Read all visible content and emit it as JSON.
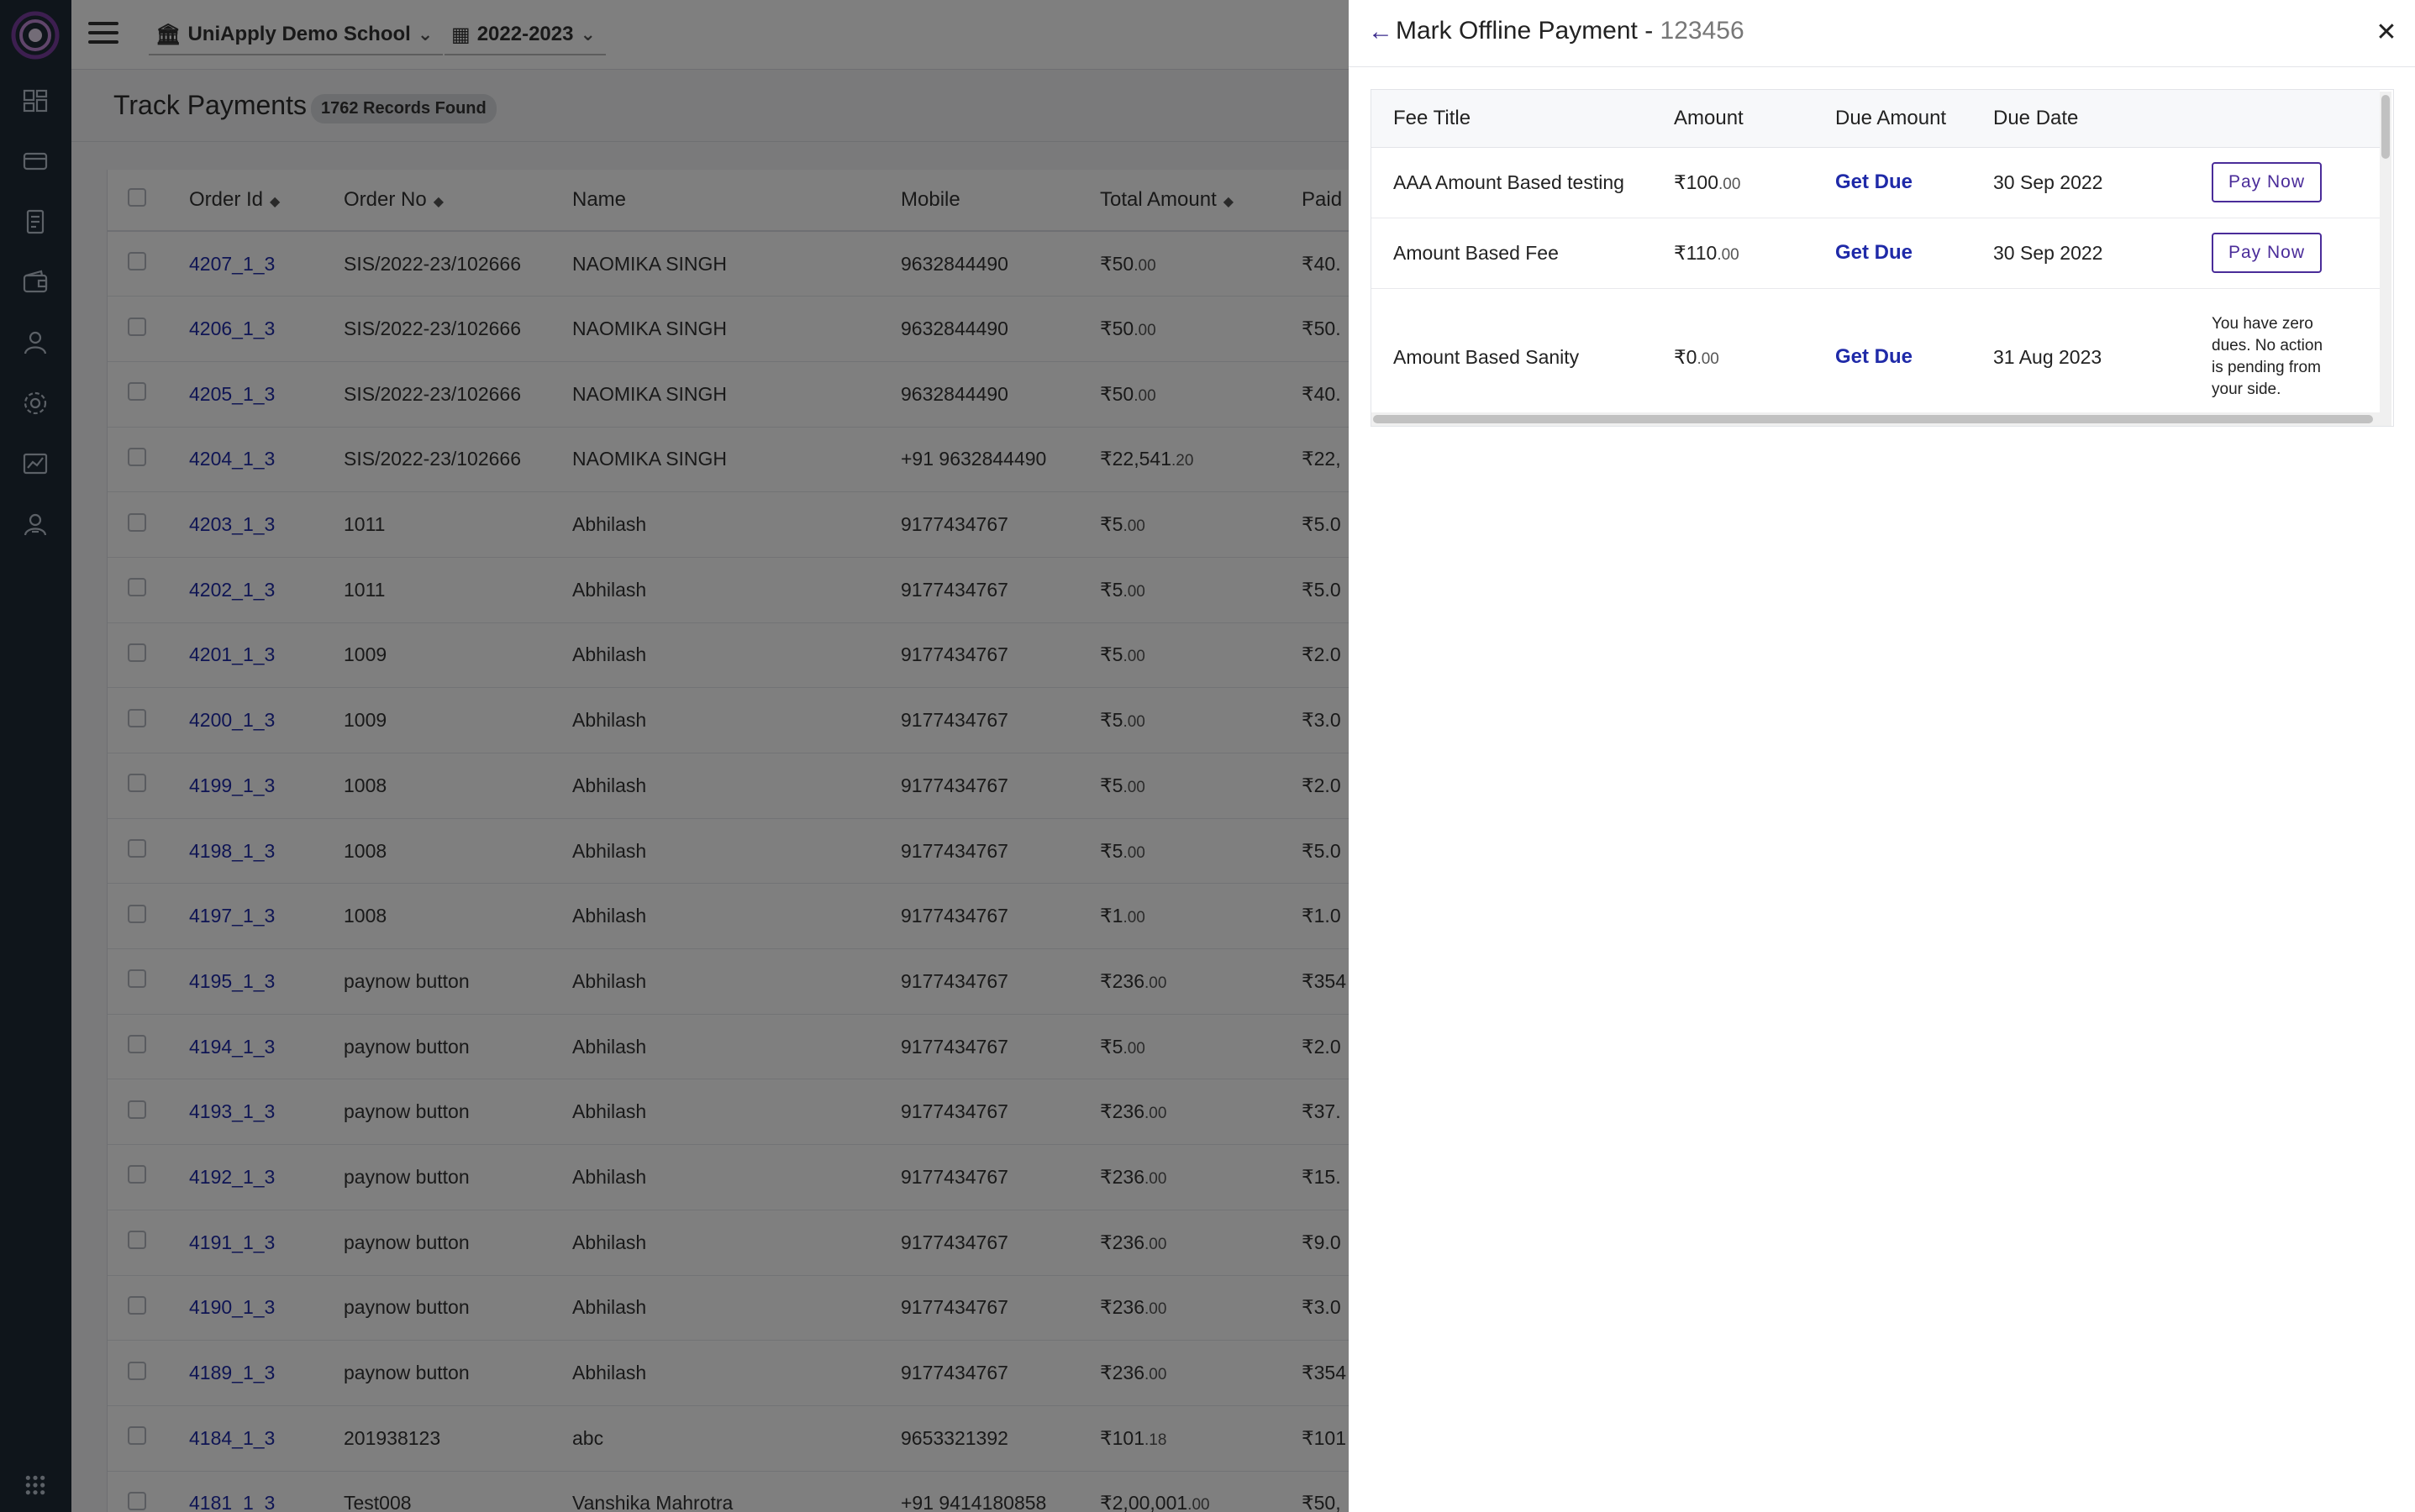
{
  "sidebar": {
    "icons": [
      "dashboard-icon",
      "card-icon",
      "document-icon",
      "wallet-icon",
      "user-icon",
      "settings-icon",
      "report-icon",
      "admin-icon"
    ],
    "bottom_icon": "apps-grid-icon"
  },
  "topbar": {
    "school": "UniApply Demo School",
    "session": "2022-2023"
  },
  "page": {
    "title": "Track Payments",
    "records": "1762 Records Found"
  },
  "orders_table": {
    "columns": [
      "Order Id",
      "Order No",
      "Name",
      "Mobile",
      "Total Amount",
      "Paid"
    ],
    "rows": [
      {
        "id": "4207_1_3",
        "no": "SIS/2022-23/102666",
        "name": "NAOMIKA SINGH",
        "mobile": "9632844490",
        "total": "₹50",
        "total_dec": ".00",
        "paid": "₹40."
      },
      {
        "id": "4206_1_3",
        "no": "SIS/2022-23/102666",
        "name": "NAOMIKA SINGH",
        "mobile": "9632844490",
        "total": "₹50",
        "total_dec": ".00",
        "paid": "₹50."
      },
      {
        "id": "4205_1_3",
        "no": "SIS/2022-23/102666",
        "name": "NAOMIKA SINGH",
        "mobile": "9632844490",
        "total": "₹50",
        "total_dec": ".00",
        "paid": "₹40."
      },
      {
        "id": "4204_1_3",
        "no": "SIS/2022-23/102666",
        "name": "NAOMIKA SINGH",
        "mobile": "+91 9632844490",
        "total": "₹22,541",
        "total_dec": ".20",
        "paid": "₹22,"
      },
      {
        "id": "4203_1_3",
        "no": "1011",
        "name": "Abhilash",
        "mobile": "9177434767",
        "total": "₹5",
        "total_dec": ".00",
        "paid": "₹5.0"
      },
      {
        "id": "4202_1_3",
        "no": "1011",
        "name": "Abhilash",
        "mobile": "9177434767",
        "total": "₹5",
        "total_dec": ".00",
        "paid": "₹5.0"
      },
      {
        "id": "4201_1_3",
        "no": "1009",
        "name": "Abhilash",
        "mobile": "9177434767",
        "total": "₹5",
        "total_dec": ".00",
        "paid": "₹2.0"
      },
      {
        "id": "4200_1_3",
        "no": "1009",
        "name": "Abhilash",
        "mobile": "9177434767",
        "total": "₹5",
        "total_dec": ".00",
        "paid": "₹3.0"
      },
      {
        "id": "4199_1_3",
        "no": "1008",
        "name": "Abhilash",
        "mobile": "9177434767",
        "total": "₹5",
        "total_dec": ".00",
        "paid": "₹2.0"
      },
      {
        "id": "4198_1_3",
        "no": "1008",
        "name": "Abhilash",
        "mobile": "9177434767",
        "total": "₹5",
        "total_dec": ".00",
        "paid": "₹5.0"
      },
      {
        "id": "4197_1_3",
        "no": "1008",
        "name": "Abhilash",
        "mobile": "9177434767",
        "total": "₹1",
        "total_dec": ".00",
        "paid": "₹1.0"
      },
      {
        "id": "4195_1_3",
        "no": "paynow button",
        "name": "Abhilash",
        "mobile": "9177434767",
        "total": "₹236",
        "total_dec": ".00",
        "paid": "₹354"
      },
      {
        "id": "4194_1_3",
        "no": "paynow button",
        "name": "Abhilash",
        "mobile": "9177434767",
        "total": "₹5",
        "total_dec": ".00",
        "paid": "₹2.0"
      },
      {
        "id": "4193_1_3",
        "no": "paynow button",
        "name": "Abhilash",
        "mobile": "9177434767",
        "total": "₹236",
        "total_dec": ".00",
        "paid": "₹37."
      },
      {
        "id": "4192_1_3",
        "no": "paynow button",
        "name": "Abhilash",
        "mobile": "9177434767",
        "total": "₹236",
        "total_dec": ".00",
        "paid": "₹15."
      },
      {
        "id": "4191_1_3",
        "no": "paynow button",
        "name": "Abhilash",
        "mobile": "9177434767",
        "total": "₹236",
        "total_dec": ".00",
        "paid": "₹9.0"
      },
      {
        "id": "4190_1_3",
        "no": "paynow button",
        "name": "Abhilash",
        "mobile": "9177434767",
        "total": "₹236",
        "total_dec": ".00",
        "paid": "₹3.0"
      },
      {
        "id": "4189_1_3",
        "no": "paynow button",
        "name": "Abhilash",
        "mobile": "9177434767",
        "total": "₹236",
        "total_dec": ".00",
        "paid": "₹354"
      },
      {
        "id": "4184_1_3",
        "no": "201938123",
        "name": "abc",
        "mobile": "9653321392",
        "total": "₹101",
        "total_dec": ".18",
        "paid": "₹101"
      },
      {
        "id": "4181_1_3",
        "no": "Test008",
        "name": "Vanshika Mahrotra",
        "mobile": "+91 9414180858",
        "total": "₹2,00,001",
        "total_dec": ".00",
        "paid": "₹50,"
      }
    ]
  },
  "drawer": {
    "title": "Mark Offline Payment - ",
    "transaction_id": "123456",
    "columns": [
      "Fee Title",
      "Amount",
      "Due Amount",
      "Due Date"
    ],
    "rows": [
      {
        "title": "AAA Amount Based testing",
        "amount": "₹100",
        "amount_dec": ".00",
        "due": "Get Due",
        "date": "30 Sep 2022",
        "action": "Pay Now"
      },
      {
        "title": "Amount Based Fee",
        "amount": "₹110",
        "amount_dec": ".00",
        "due": "Get Due",
        "date": "30 Sep 2022",
        "action": "Pay Now"
      },
      {
        "title": "Amount Based Sanity",
        "amount": "₹0",
        "amount_dec": ".00",
        "due": "Get Due",
        "date": "31 Aug 2023",
        "action": "You have zero dues. No action is pending from your side."
      }
    ]
  },
  "colors": {
    "sidebar": "#1f2a37",
    "link": "#1f2aa8",
    "accent": "#4a2c99"
  }
}
